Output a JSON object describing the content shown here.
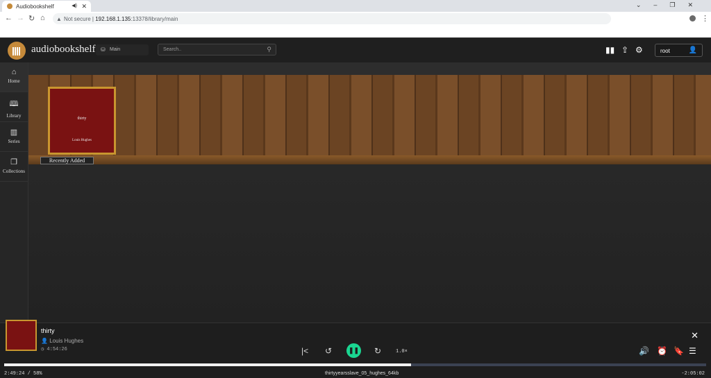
{
  "browser": {
    "tab_title": "Audiobookshelf",
    "security": "Not secure",
    "url_host": "192.168.1.135",
    "url_rest": ":13378/library/main"
  },
  "app": {
    "brand": "audiobookshelf",
    "library": "Main",
    "search_placeholder": "Search..",
    "user": "root"
  },
  "sidebar": {
    "items": [
      {
        "label": "Home",
        "icon": "⌂"
      },
      {
        "label": "Library",
        "icon": "🕮"
      },
      {
        "label": "Series",
        "icon": "▥"
      },
      {
        "label": "Collections",
        "icon": "❐"
      }
    ]
  },
  "shelf": {
    "label": "Recently Added",
    "book": {
      "title": "thirty",
      "author": "Louis Hughes"
    }
  },
  "player": {
    "title": "thirty",
    "author": "Louis Hughes",
    "duration": "4:54:26",
    "rate": "1.0×",
    "current": "2:49:24 / 58%",
    "progress": 58,
    "file": "thirtyyearsslave_05_hughes_64kb",
    "remaining": "-2:05:02"
  }
}
